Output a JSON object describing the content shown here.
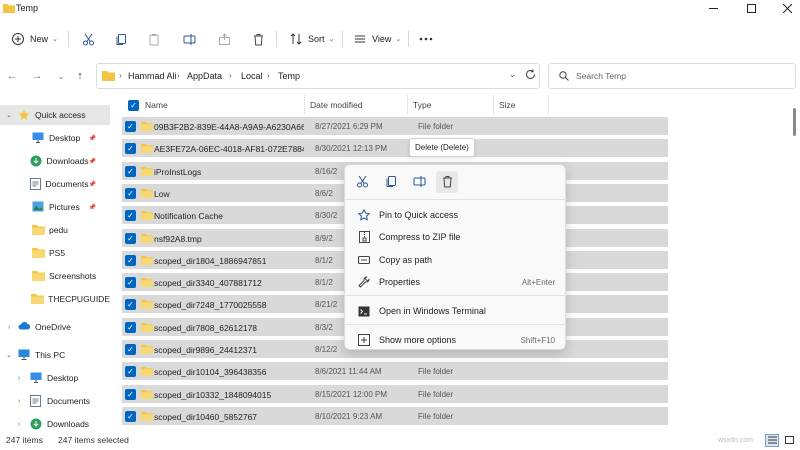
{
  "window": {
    "title": "Temp"
  },
  "toolbar": {
    "new_label": "New",
    "sort_label": "Sort",
    "view_label": "View"
  },
  "address": {
    "breadcrumbs": [
      "Hammad Ali",
      "AppData",
      "Local",
      "Temp"
    ]
  },
  "search": {
    "placeholder": "Search Temp"
  },
  "nav": {
    "items": [
      {
        "label": "Quick access",
        "icon": "star-icon"
      },
      {
        "label": "Desktop",
        "icon": "desktop-icon",
        "pinned": true
      },
      {
        "label": "Downloads",
        "icon": "download-icon",
        "pinned": true
      },
      {
        "label": "Documents",
        "icon": "documents-icon",
        "pinned": true
      },
      {
        "label": "Pictures",
        "icon": "pictures-icon",
        "pinned": true
      },
      {
        "label": "pedu",
        "icon": "folder-icon"
      },
      {
        "label": "PS5",
        "icon": "folder-icon"
      },
      {
        "label": "Screenshots",
        "icon": "folder-icon"
      },
      {
        "label": "THECPUGUIDE",
        "icon": "folder-icon"
      },
      {
        "label": "OneDrive",
        "icon": "cloud-icon"
      },
      {
        "label": "This PC",
        "icon": "pc-icon"
      },
      {
        "label": "Desktop",
        "icon": "desktop-icon"
      },
      {
        "label": "Documents",
        "icon": "documents-icon"
      },
      {
        "label": "Downloads",
        "icon": "download-icon"
      }
    ]
  },
  "columns": {
    "name": "Name",
    "date": "Date modified",
    "type": "Type",
    "size": "Size"
  },
  "files": [
    {
      "name": "09B3F2B2-839E-44A8-A9A9-A6230A66...",
      "date": "8/27/2021 6:29 PM",
      "type": "File folder"
    },
    {
      "name": "AE3FE72A-06EC-4018-AF81-072E7884F...",
      "date": "8/30/2021 12:13 PM",
      "type": ""
    },
    {
      "name": "iProInstLogs",
      "date": "8/16/2",
      "type": ""
    },
    {
      "name": "Low",
      "date": "8/6/2",
      "type": ""
    },
    {
      "name": "Notification Cache",
      "date": "8/30/2",
      "type": ""
    },
    {
      "name": "nsf92A8.tmp",
      "date": "8/9/2",
      "type": ""
    },
    {
      "name": "scoped_dir1804_1886947851",
      "date": "8/1/2",
      "type": ""
    },
    {
      "name": "scoped_dir3340_407881712",
      "date": "8/1/2",
      "type": ""
    },
    {
      "name": "scoped_dir7248_1770025558",
      "date": "8/21/2",
      "type": ""
    },
    {
      "name": "scoped_dir7808_62612178",
      "date": "8/3/2",
      "type": ""
    },
    {
      "name": "scoped_dir9896_24412371",
      "date": "8/12/2",
      "type": ""
    },
    {
      "name": "scoped_dir10104_396438356",
      "date": "8/6/2021 11:44 AM",
      "type": "File folder"
    },
    {
      "name": "scoped_dir10332_1848094015",
      "date": "8/15/2021 12:00 PM",
      "type": "File folder"
    },
    {
      "name": "scoped_dir10460_5852767",
      "date": "8/10/2021 9:23 AM",
      "type": "File folder"
    }
  ],
  "tooltip": "Delete (Delete)",
  "context_menu": {
    "items": [
      {
        "label": "Pin to Quick access",
        "icon": "star-outline-icon",
        "shortcut": ""
      },
      {
        "label": "Compress to ZIP file",
        "icon": "zip-icon",
        "shortcut": ""
      },
      {
        "label": "Copy as path",
        "icon": "copy-path-icon",
        "shortcut": ""
      },
      {
        "label": "Properties",
        "icon": "wrench-icon",
        "shortcut": "Alt+Enter"
      },
      {
        "label": "Open in Windows Terminal",
        "icon": "terminal-icon",
        "shortcut": ""
      },
      {
        "label": "Show more options",
        "icon": "more-options-icon",
        "shortcut": "Shift+F10"
      }
    ]
  },
  "status": {
    "item_count": "247 items",
    "selected_count": "247 items selected"
  },
  "watermark": "wsxdn.com",
  "colors": {
    "accent": "#0067c0",
    "folder": "#f4c542",
    "selection": "#d9d9d9"
  }
}
